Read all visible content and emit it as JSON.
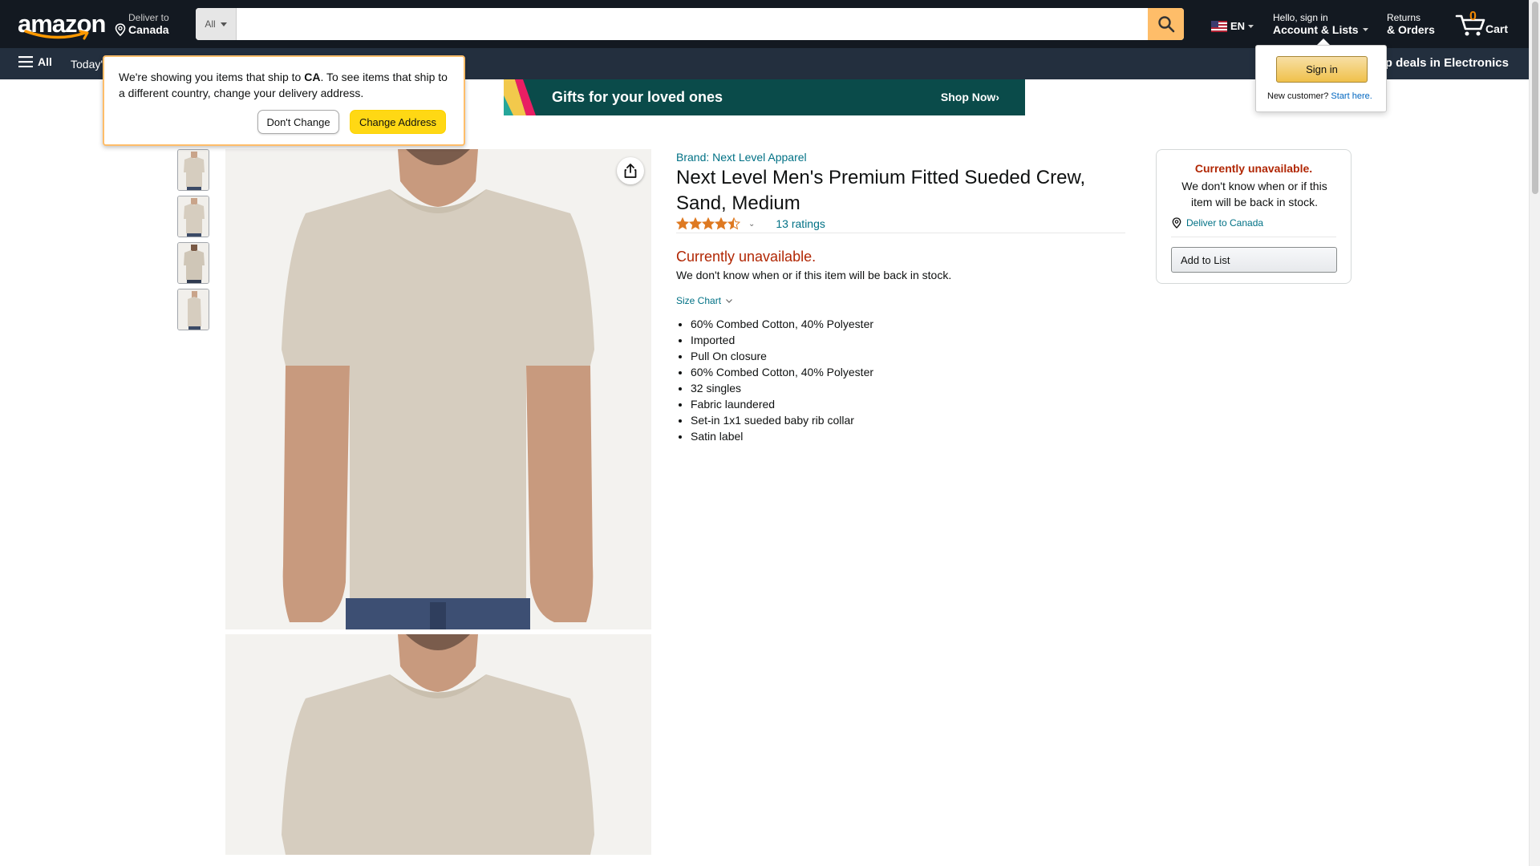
{
  "header": {
    "logo": "amazon",
    "deliver_to_small": "Deliver to",
    "deliver_to_country": "Canada",
    "search_category": "All",
    "search_placeholder": "",
    "language": "EN",
    "account_small": "Hello, sign in",
    "account_big": "Account & Lists",
    "returns_small": "Returns",
    "returns_big": "& Orders",
    "cart_count": "0",
    "cart_label": "Cart"
  },
  "subnav": {
    "all_label": "All",
    "today": "Today's",
    "shop_deals": "Shop deals in Electronics"
  },
  "ship_popover": {
    "message_before": "We're showing you items that ship to ",
    "country_code": "CA",
    "message_after": ". To see items that ship to a different country, change your delivery address.",
    "dont_change": "Don't Change",
    "change_address": "Change Address"
  },
  "signin_popover": {
    "sign_in": "Sign in",
    "new_customer": "New customer?",
    "start_here": "Start here."
  },
  "banner": {
    "text": "Gifts for your loved ones",
    "cta": "Shop Now›"
  },
  "product": {
    "brand": "Brand: Next Level Apparel",
    "title": "Next Level Men's Premium Fitted Sueded Crew, Sand, Medium",
    "rating": 4.5,
    "ratings_count": "13 ratings",
    "unavailable": "Currently unavailable.",
    "unavailable_sub": "We don't know when or if this item will be back in stock.",
    "size_chart": "Size Chart",
    "bullets": [
      "60% Combed Cotton, 40% Polyester",
      "Imported",
      "Pull On closure",
      "60% Combed Cotton, 40% Polyester",
      "32 singles",
      "Fabric laundered",
      "Set-in 1x1 sueded baby rib collar",
      "Satin label"
    ]
  },
  "buybox": {
    "unavailable": "Currently unavailable.",
    "sub": "We don't know when or if this item will be back in stock.",
    "deliver": "Deliver to Canada",
    "add_to_list": "Add to List"
  },
  "colors": {
    "nav_bg": "#131921",
    "subnav_bg": "#232f3e",
    "search_button": "#febd69",
    "link": "#007185",
    "unavailable": "#b12704",
    "primary_button": "#ffd814",
    "star": "#de7921",
    "shirt": "#d6cdbf"
  }
}
